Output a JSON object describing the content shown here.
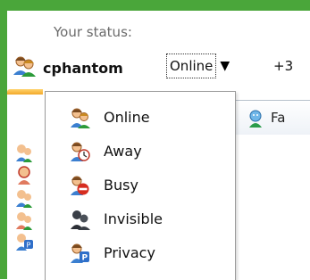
{
  "status_panel": {
    "caption": "Your status:",
    "username": "cphantom",
    "current_status": "Online",
    "extra_count": "+3"
  },
  "tab": {
    "label": "Fa"
  },
  "status_menu": {
    "items": [
      {
        "label": "Online",
        "icon": "user-online-icon"
      },
      {
        "label": "Away",
        "icon": "user-away-icon"
      },
      {
        "label": "Busy",
        "icon": "user-busy-icon"
      },
      {
        "label": "Invisible",
        "icon": "user-invisible-icon"
      },
      {
        "label": "Privacy",
        "icon": "user-privacy-icon"
      }
    ]
  },
  "colors": {
    "frame_green": "#4aa63a",
    "menu_border": "#9a9a9a",
    "menu_highlight": "#cfe0f5"
  }
}
